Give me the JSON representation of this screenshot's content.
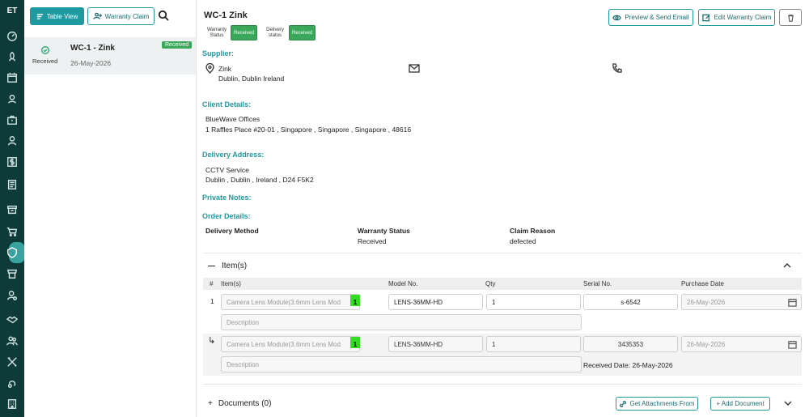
{
  "rail": {
    "logo": "ET",
    "items": [
      "dashboard-icon",
      "rocket-icon",
      "calendar-icon",
      "map-pin-user-icon",
      "briefcase-icon",
      "user-icon",
      "dollar-icon",
      "document-icon",
      "archive-icon",
      "cart-icon",
      "warranty-icon",
      "store-icon",
      "user-settings-icon",
      "handshake-icon",
      "team-icon",
      "tools-icon",
      "location-refresh-icon",
      "building-icon"
    ]
  },
  "list": {
    "table_view_label": "Table View",
    "warranty_claim_label": "Warranty Claim",
    "card": {
      "status": "Received",
      "title": "WC-1 - Zink",
      "date": "26-May-2026",
      "badge": "Received"
    }
  },
  "header": {
    "title": "WC-1 Zink",
    "warranty_status_label": "Warranty\nStatus",
    "warranty_status_value": "Received",
    "delivery_status_label": "Delivery\nstatus",
    "delivery_status_value": "Received",
    "preview_label": "Preview & Send Email",
    "edit_label": "Edit Warranty Claim"
  },
  "supplier": {
    "heading": "Supplier:",
    "name": "Zink",
    "address": "Dublin, Dublin Ireland"
  },
  "client": {
    "heading": "Client Details:",
    "name": "BlueWave Offices",
    "address": "1 Raffles Place #20-01 , Singapore , Singapore , Singapore , 48616"
  },
  "delivery": {
    "heading": "Delivery Address:",
    "name": "CCTV Service",
    "address": "Dublin , Dublin , Ireland , D24 F5K2"
  },
  "private_notes": {
    "heading": "Private Notes:"
  },
  "order": {
    "heading": "Order Details:",
    "delivery_method_label": "Delivery Method",
    "warranty_status_label": "Warranty Status",
    "warranty_status_value": "Received",
    "claim_reason_label": "Claim Reason",
    "claim_reason_value": "defected"
  },
  "items": {
    "heading": "Item(s)",
    "columns": {
      "num": "#",
      "item": "Item(s)",
      "model": "Model No.",
      "qty": "Qty",
      "serial": "Serial No.",
      "purchase": "Purchase Date"
    },
    "row1": {
      "num": "1",
      "item": "Camera Lens Module(3.6mm Lens Mod",
      "qty_tag": "1",
      "model": "LENS-36MM-HD",
      "qty": "1",
      "serial": "s-6542",
      "purchase": "26-May-2026",
      "description_placeholder": "Description"
    },
    "row2": {
      "num": "↳",
      "item": "Camera Lens Module(3.6mm Lens Mod",
      "qty_tag": "1",
      "model": "LENS-36MM-HD",
      "qty": "1",
      "serial": "3435353",
      "purchase": "26-May-2026",
      "description_placeholder": "Description",
      "received_date": "Received Date: 26-May-2026"
    }
  },
  "documents": {
    "heading": "Documents (0)",
    "get_attachments_label": "Get Attachments From",
    "add_document_label": "+ Add Document"
  },
  "colors": {
    "rail": "#0e3b3a",
    "accent": "#1f9aa0",
    "badge_green": "#3aa75a"
  }
}
